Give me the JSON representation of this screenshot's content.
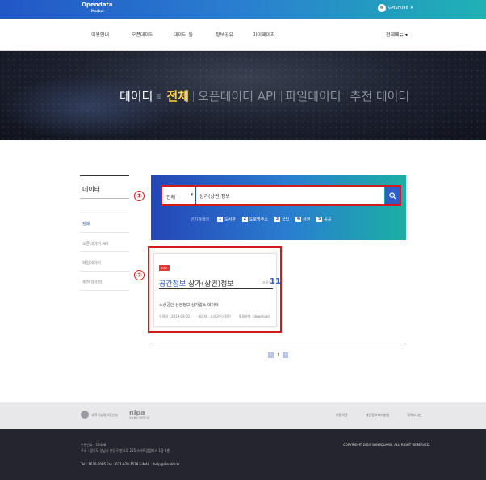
{
  "topbar": {
    "logo_line1": "Opendata",
    "logo_line2": "Market",
    "username": "GMSH098",
    "caret": "▾"
  },
  "nav": {
    "items": [
      "이용안내",
      "오픈데이터",
      "데이터 툴",
      "정보공유",
      "마이페이지"
    ],
    "all_menu": "전체메뉴 ▾"
  },
  "hero": {
    "root": "데이터",
    "circle": "◎",
    "active": "전체",
    "items": [
      "오픈데이터 API",
      "파일데이터",
      "추천 데이터"
    ]
  },
  "sidebar": {
    "title": "데이터",
    "items": [
      "전체",
      "오픈데이터 API",
      "파일데이터",
      "추천 데이터"
    ]
  },
  "search": {
    "select_value": "전체",
    "select_caret": "▾",
    "query": "상가(상권)정보",
    "popular_label": "인기검색어",
    "keywords": [
      {
        "num": "1",
        "text": "도서관"
      },
      {
        "num": "2",
        "text": "도로명주소"
      },
      {
        "num": "3",
        "text": "국립"
      },
      {
        "num": "4",
        "text": "상권"
      },
      {
        "num": "5",
        "text": "공공"
      }
    ]
  },
  "markers": {
    "one": "①",
    "two": "②"
  },
  "result": {
    "badge": "csv",
    "category": "공간정보",
    "title": "상가(상권)정보",
    "views_label": "조회수",
    "views": "11",
    "description": "소상공인 상권정보 상가업소 데이터",
    "modified": "수정일 : 2019-04-02",
    "provider": "제공처 : 소상공인시장진",
    "format": "활용유형 : download"
  },
  "pager": {
    "prev": "‹",
    "page": "1",
    "next": "›"
  },
  "footer": {
    "org": "과학기술정보통신부",
    "logo": "nipa",
    "logo_sub": "정보통신산업진흥원",
    "links": [
      "이용약관",
      "개인정보처리방침",
      "찾아오시는"
    ],
    "addr1": "우편번호 : 13488",
    "addr2": "주소 : 경기도 성남시 분당구 판교로 235 스타트업캠퍼스 1동 4층",
    "contact": "Tel : 1670-5005   Fax : 031-628-1578   E-MAIL : help@cloudor.kr",
    "copyright": "COPYRIGHT 2019 WINSQUARE. ALL RIGHT RESERVED."
  },
  "colors": {
    "accent": "#2f5fc6",
    "highlight_red": "#d01c1c",
    "hero_active": "#ffd340"
  }
}
